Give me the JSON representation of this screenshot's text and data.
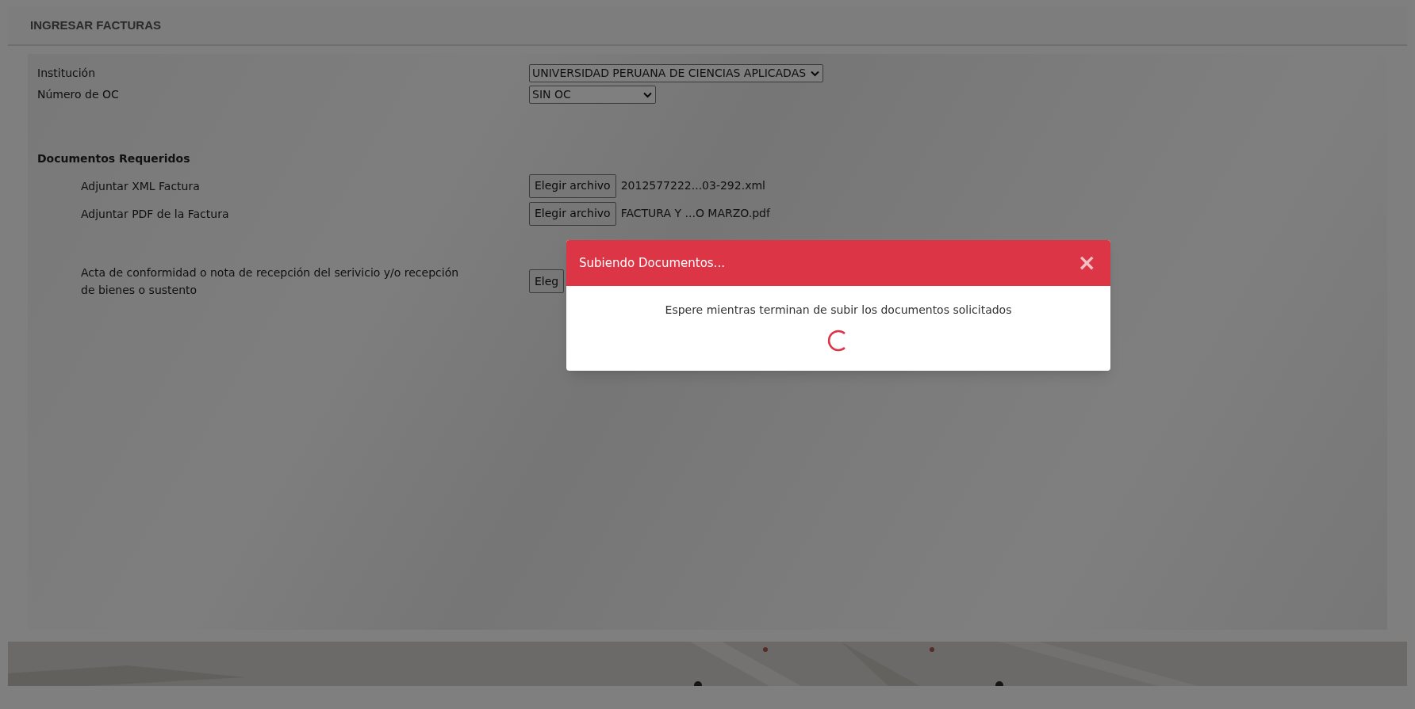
{
  "page_title": "INGRESAR FACTURAS",
  "fields": [
    {
      "label": "Institución",
      "value": "UNIVERSIDAD PERUANA DE CIENCIAS APLICADAS",
      "kind": "select",
      "wide": true
    },
    {
      "label": "Número de OC",
      "value": "SIN OC",
      "kind": "select",
      "wide": false
    }
  ],
  "section_title": "Documentos Requeridos",
  "documents": [
    {
      "label": "Adjuntar XML Factura",
      "button": "Elegir archivo",
      "file": "2012577222...03-292.xml"
    },
    {
      "label": "Adjuntar PDF de la Factura",
      "button": "Elegir archivo",
      "file": "FACTURA Y ...O MARZO.pdf"
    },
    {
      "label": "Acta de conformidad o nota de recepción del serivicio y/o recepción de bienes o sustento",
      "button": "Eleg"
    }
  ],
  "modal": {
    "title": "Subiendo Documentos...",
    "close": "×",
    "message": "Espere mientras terminan de subir los documentos solicitados",
    "loading": true
  }
}
